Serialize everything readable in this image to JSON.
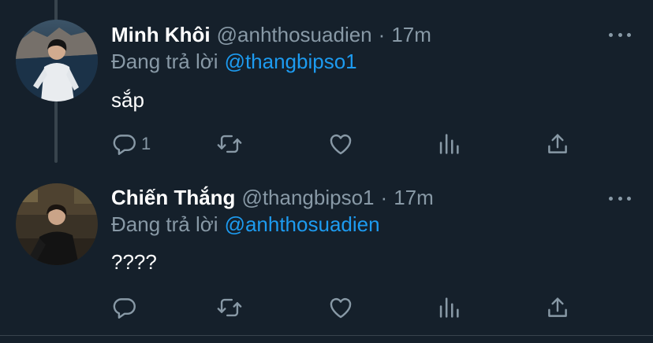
{
  "tweets": [
    {
      "author_name": "Minh Khôi",
      "handle": "@anhthosuadien",
      "separator": "·",
      "time": "17m",
      "replying_prefix": "Đang trả lời",
      "replying_to": "@thangbipso1",
      "text": "sắp",
      "reply_count": "1",
      "icons": [
        "reply-icon",
        "retweet-icon",
        "like-icon",
        "stats-icon",
        "share-icon",
        "more-icon"
      ]
    },
    {
      "author_name": "Chiến Thắng",
      "handle": "@thangbipso1",
      "separator": "·",
      "time": "17m",
      "replying_prefix": "Đang trả lời",
      "replying_to": "@anhthosuadien",
      "text": "????",
      "reply_count": "",
      "icons": [
        "reply-icon",
        "retweet-icon",
        "like-icon",
        "stats-icon",
        "share-icon",
        "more-icon"
      ]
    }
  ],
  "colors": {
    "background": "#15202b",
    "text_primary": "#ffffff",
    "text_secondary": "#8899a6",
    "accent": "#1d9bf0",
    "border": "#38444d"
  }
}
